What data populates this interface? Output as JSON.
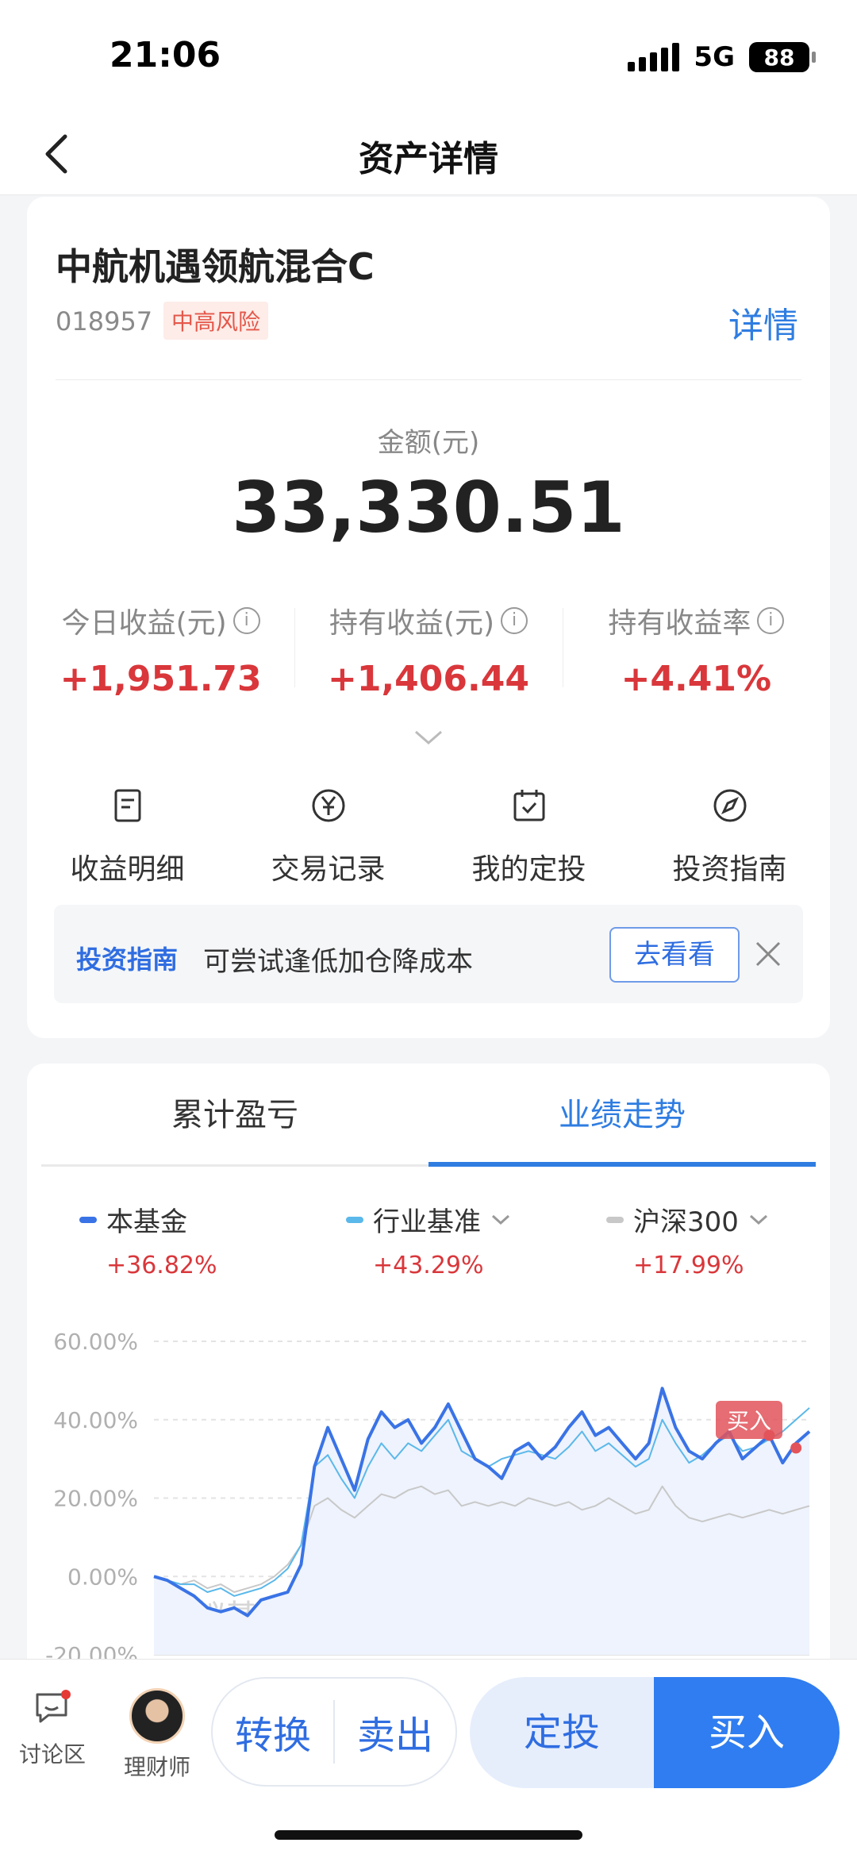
{
  "status": {
    "time": "21:06",
    "network": "5G",
    "battery": "88"
  },
  "nav": {
    "title": "资产详情"
  },
  "fund": {
    "name": "中航机遇领航混合C",
    "code": "018957",
    "risk": "中高风险",
    "detail_link": "详情",
    "amount_label": "金额(元)",
    "amount": "33,330.51"
  },
  "stats": [
    {
      "label": "今日收益(元)",
      "value": "+1,951.73"
    },
    {
      "label": "持有收益(元)",
      "value": "+1,406.44"
    },
    {
      "label": "持有收益率",
      "value": "+4.41%"
    }
  ],
  "shortcuts": [
    {
      "label": "收益明细",
      "icon": "document-icon"
    },
    {
      "label": "交易记录",
      "icon": "yen-circle-icon"
    },
    {
      "label": "我的定投",
      "icon": "calendar-icon"
    },
    {
      "label": "投资指南",
      "icon": "compass-icon"
    }
  ],
  "guide": {
    "title": "投资指南",
    "text": "可尝试逢低加仓降成本",
    "button": "去看看"
  },
  "tabs": {
    "cumulative": "累计盈亏",
    "performance": "业绩走势"
  },
  "legend": [
    {
      "name": "本基金",
      "value": "+36.82%",
      "color": "#3a73e6"
    },
    {
      "name": "行业基准",
      "value": "+43.29%",
      "color": "#5bb8ea"
    },
    {
      "name": "沪深300",
      "value": "+17.99%",
      "color": "#bfbfbf"
    }
  ],
  "chart_data": {
    "type": "line",
    "ylim": [
      -20,
      60
    ],
    "yticks": [
      "60.00%",
      "40.00%",
      "20.00%",
      "0.00%",
      "-20.00%"
    ],
    "watermark": "蚂蚁基金",
    "marker_label": "买入",
    "series": [
      {
        "name": "本基金",
        "color": "#3a73e6",
        "values": [
          0,
          -1,
          -3,
          -5,
          -8,
          -9,
          -8,
          -10,
          -6,
          -5,
          -4,
          3,
          28,
          38,
          30,
          22,
          35,
          42,
          38,
          40,
          34,
          38,
          44,
          37,
          30,
          28,
          25,
          32,
          34,
          30,
          33,
          38,
          42,
          36,
          38,
          34,
          30,
          34,
          48,
          38,
          32,
          30,
          34,
          37,
          30,
          33,
          36,
          29,
          34,
          37
        ]
      },
      {
        "name": "行业基准",
        "color": "#5bb8ea",
        "values": [
          0,
          -1,
          -2,
          -2,
          -4,
          -3,
          -5,
          -4,
          -3,
          -1,
          2,
          8,
          28,
          31,
          25,
          20,
          28,
          34,
          30,
          34,
          32,
          36,
          40,
          32,
          30,
          28,
          30,
          31,
          32,
          31,
          30,
          33,
          37,
          32,
          34,
          31,
          28,
          30,
          40,
          34,
          29,
          31,
          34,
          36,
          32,
          33,
          35,
          37,
          40,
          43
        ]
      },
      {
        "name": "沪深300",
        "color": "#c8c8c8",
        "values": [
          0,
          -1,
          -2,
          -1,
          -3,
          -2,
          -4,
          -3,
          -2,
          0,
          3,
          8,
          18,
          20,
          17,
          15,
          18,
          21,
          20,
          22,
          23,
          21,
          22,
          18,
          19,
          18,
          19,
          18,
          20,
          19,
          18,
          19,
          17,
          18,
          20,
          18,
          16,
          17,
          23,
          18,
          15,
          14,
          15,
          16,
          15,
          16,
          17,
          16,
          17,
          18
        ]
      }
    ]
  },
  "bottom": {
    "forum": "讨论区",
    "advisor": "理财师",
    "convert": "转换",
    "sell": "卖出",
    "plan": "定投",
    "buy": "买入"
  }
}
